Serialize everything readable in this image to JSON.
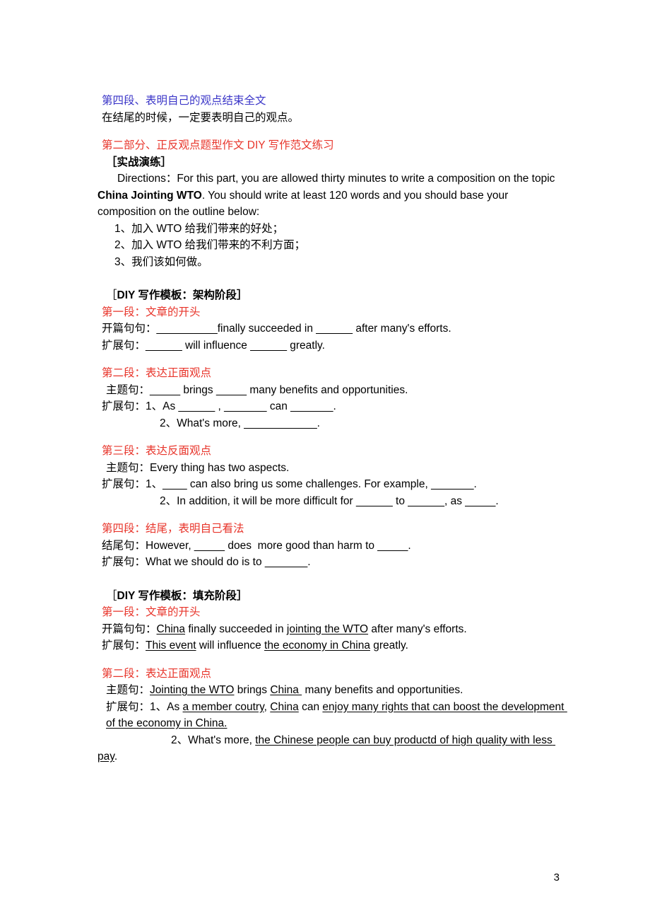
{
  "document": {
    "page_number": "3",
    "colors": {
      "blue_heading": "#3b36c8",
      "red_heading": "#e8352b",
      "body_text": "#000000"
    }
  },
  "section_prev": {
    "heading": "第四段、表明自己的观点结束全文",
    "body": "在结尾的时候，一定要表明自己的观点。"
  },
  "part_two": {
    "heading": "第二部分、正反观点题型作文 DIY 写作范文练习",
    "subheading": "［实战演练］",
    "directions": {
      "lead": "Directions：For this part, you are allowed thirty minutes to write a composition on the topic ",
      "topic": "China Jointing WTO",
      "tail": ". You should write at least 120 words and you should base your composition on the outline below:"
    },
    "outline": [
      "1、加入 WTO 给我们带来的好处；",
      "2、加入 WTO 给我们带来的不利方面；",
      "3、我们该如何做。"
    ]
  },
  "template_framework": {
    "title_prefix": "［",
    "title_bold": "DIY",
    "title_rest": " 写作模板：架构阶段］",
    "paragraphs": [
      {
        "heading": "第一段：文章的开头",
        "lines": [
          {
            "label": "开篇句句：",
            "text": "__________finally succeeded in ______ after many's efforts."
          },
          {
            "label": "扩展句：",
            "text": "______ will influence ______ greatly."
          }
        ]
      },
      {
        "heading": "第二段：表达正面观点",
        "lines": [
          {
            "label": "主题句：",
            "text": "_____ brings _____ many benefits and opportunities."
          },
          {
            "label": "扩展句：",
            "text": "1、As ______ , _______ can _______."
          },
          {
            "label": "",
            "text": "2、What's more, ____________."
          }
        ]
      },
      {
        "heading": "第三段：表达反面观点",
        "lines": [
          {
            "label": "主题句：",
            "text": "Every thing has two aspects."
          },
          {
            "label": "扩展句：",
            "text": "1、____ can also bring us some challenges. For example, _______."
          },
          {
            "label": "",
            "text": "2、In addition, it will be more difficult for ______ to ______, as _____."
          }
        ]
      },
      {
        "heading": "第四段：结尾，表明自己看法",
        "lines": [
          {
            "label": "结尾句：",
            "text": "However, _____ does  more good than harm to _____."
          },
          {
            "label": "扩展句：",
            "text": "What we should do is to _______."
          }
        ]
      }
    ]
  },
  "template_filled": {
    "title_prefix": "［",
    "title_bold": "DIY",
    "title_rest": " 写作模板：填充阶段］",
    "paragraphs": [
      {
        "heading": "第一段：文章的开头",
        "lines": [
          {
            "label": "开篇句句：",
            "segments": [
              {
                "text": "China",
                "underline": true
              },
              {
                "text": " finally succeeded in ",
                "underline": false
              },
              {
                "text": "jointing the WTO",
                "underline": true
              },
              {
                "text": " after many's efforts.",
                "underline": false
              }
            ]
          },
          {
            "label": "扩展句：",
            "segments": [
              {
                "text": "This event",
                "underline": true
              },
              {
                "text": " will influence ",
                "underline": false
              },
              {
                "text": "the economy in China",
                "underline": true
              },
              {
                "text": " greatly.",
                "underline": false
              }
            ]
          }
        ]
      },
      {
        "heading": "第二段：表达正面观点",
        "lines": [
          {
            "label": "主题句：",
            "segments": [
              {
                "text": "Jointing the WTO",
                "underline": true
              },
              {
                "text": " brings ",
                "underline": false
              },
              {
                "text": "China ",
                "underline": true
              },
              {
                "text": " many benefits and opportunities.",
                "underline": false
              }
            ]
          },
          {
            "label": "扩展句：",
            "segments": [
              {
                "text": "1、As ",
                "underline": false
              },
              {
                "text": "a member coutry",
                "underline": true
              },
              {
                "text": ", ",
                "underline": false
              },
              {
                "text": "China",
                "underline": true
              },
              {
                "text": " can ",
                "underline": false
              },
              {
                "text": "enjoy many rights that can boost the development of the economy in China.",
                "underline": true
              }
            ]
          },
          {
            "label": "",
            "segments": [
              {
                "text": "2、What's more, ",
                "underline": false
              },
              {
                "text": "the Chinese people can buy productd of high quality with less pay",
                "underline": true
              },
              {
                "text": ".",
                "underline": false
              }
            ]
          }
        ]
      }
    ]
  }
}
